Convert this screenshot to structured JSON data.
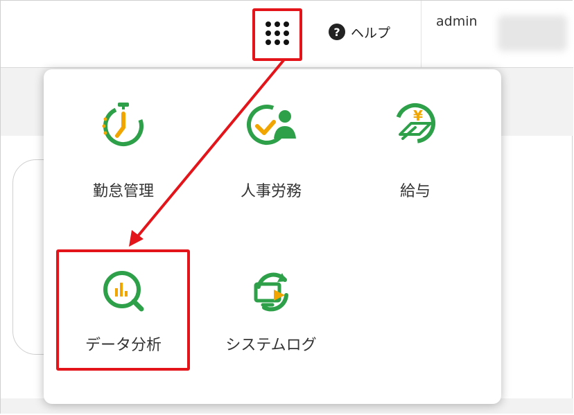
{
  "header": {
    "apps_button": "app-launcher",
    "help_label": "ヘルプ",
    "help_symbol": "?",
    "user_label": "admin"
  },
  "menu": {
    "items": [
      {
        "label": "勤怠管理",
        "icon": "stopwatch-icon"
      },
      {
        "label": "人事労務",
        "icon": "check-person-icon"
      },
      {
        "label": "給与",
        "icon": "yen-money-icon"
      },
      {
        "label": "データ分析",
        "icon": "chart-magnifier-icon"
      },
      {
        "label": "システムログ",
        "icon": "log-screen-icon"
      }
    ]
  },
  "colors": {
    "accent_green": "#2ea04a",
    "accent_orange": "#f0a500",
    "highlight_red": "#e4141b"
  }
}
